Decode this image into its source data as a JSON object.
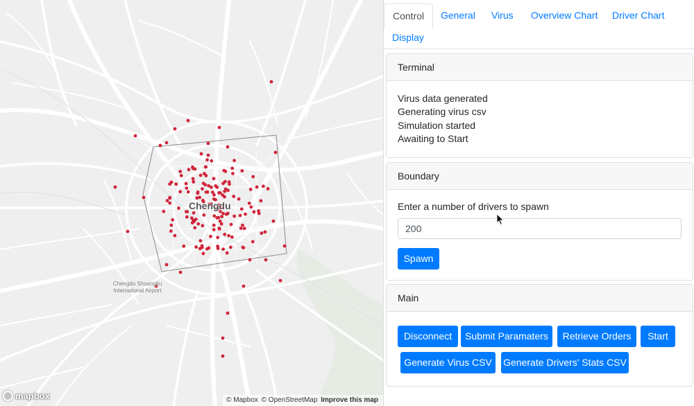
{
  "map": {
    "city_label": "Chengdu",
    "airport_label": "Chengdu Shuangliu International Airport",
    "logo_text": "mapbox",
    "attribution": {
      "mapbox": "© Mapbox",
      "osm": "© OpenStreetMap",
      "improve": "Improve this map"
    },
    "marker_color": "#d0253a"
  },
  "tabs": [
    {
      "label": "Control",
      "active": true
    },
    {
      "label": "General",
      "active": false
    },
    {
      "label": "Virus",
      "active": false
    },
    {
      "label": "Overview Chart",
      "active": false
    },
    {
      "label": "Driver Chart",
      "active": false
    },
    {
      "label": "Display",
      "active": false
    }
  ],
  "terminal": {
    "title": "Terminal",
    "lines": [
      "Virus data generated",
      "Generating virus csv",
      "Simulation started",
      "Awaiting to Start"
    ]
  },
  "boundary": {
    "title": "Boundary",
    "prompt": "Enter a number of drivers to spawn",
    "input_value": "200",
    "spawn_label": "Spawn"
  },
  "main": {
    "title": "Main",
    "buttons": {
      "disconnect": "Disconnect",
      "submit": "Submit Paramaters",
      "retrieve": "Retrieve Orders",
      "start": "Start",
      "gen_virus": "Generate Virus CSV",
      "gen_drivers": "Generate Drivers' Stats CSV"
    }
  },
  "colors": {
    "accent": "#007bff",
    "map_bg": "#efefef"
  }
}
